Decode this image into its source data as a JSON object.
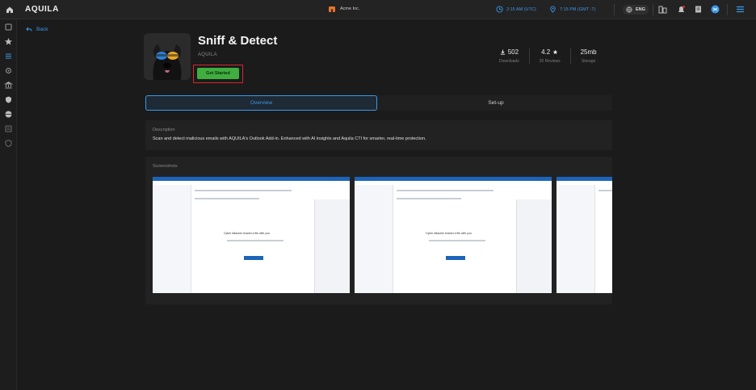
{
  "topbar": {
    "app_name": "AQUILA",
    "org_name": "Acme Inc.",
    "utc_time": "2:15 AM (UTC)",
    "local_time": "7:15 PM (GMT -7)",
    "language": "ENG"
  },
  "nav": {
    "back_label": "Back"
  },
  "product": {
    "name": "Sniff & Detect",
    "vendor": "AQUILA",
    "cta_label": "Get Started",
    "stats": [
      {
        "value": "502",
        "label": "Downloads",
        "icon": "download-icon"
      },
      {
        "value": "4.2",
        "label": "20 Reviews",
        "icon": "star-icon"
      },
      {
        "value": "25mb",
        "label": "Storage",
        "icon": ""
      }
    ]
  },
  "tabs": [
    {
      "label": "Overview",
      "active": true
    },
    {
      "label": "Set-up",
      "active": false
    }
  ],
  "description": {
    "heading": "Description",
    "text": "Scan and detect malicious emails with AQUILA's Outlook Add-in. Enhanced with AI insights and Aquila CTI for smarter, real-time protection."
  },
  "screenshots": {
    "heading": "Screenshots",
    "caption": "Cyber Attacker shared a file with you."
  },
  "colors": {
    "accent": "#3a98e8",
    "cta": "#3fae3f",
    "highlight": "#d7262b",
    "background": "#1b1b1b"
  }
}
